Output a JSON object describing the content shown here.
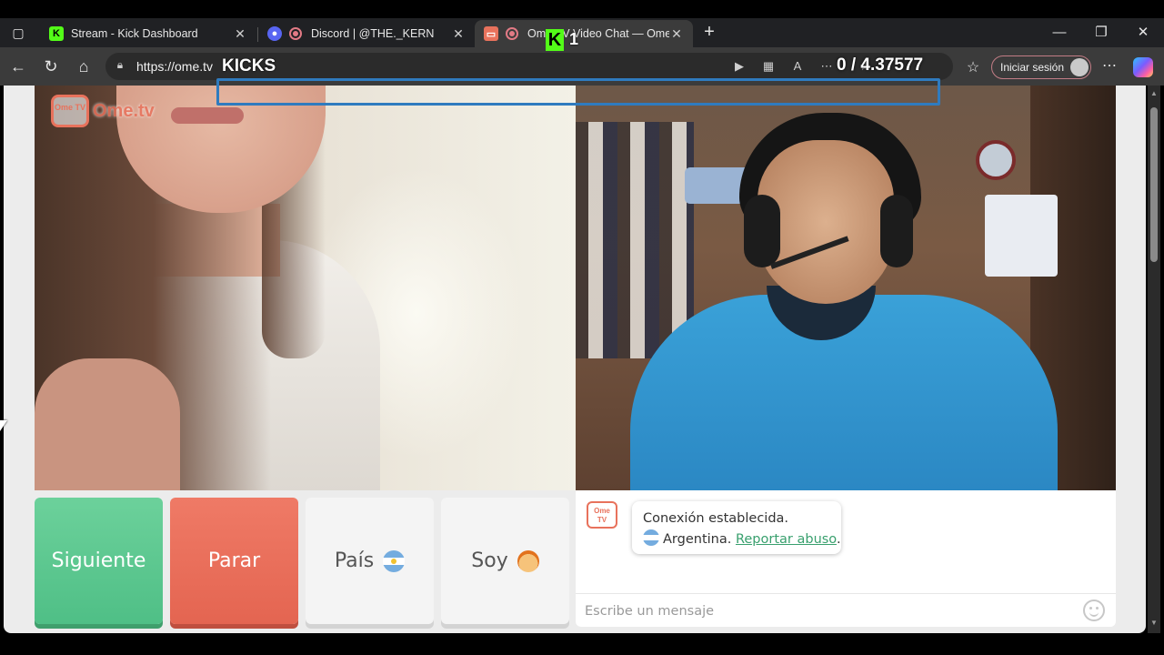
{
  "browser": {
    "tabs": [
      {
        "label": "Stream - Kick Dashboard",
        "favicon": "kick-icon",
        "active": false
      },
      {
        "label": "Discord | @THE._KERN",
        "favicon": "discord-icon",
        "active": false
      },
      {
        "label": "Ome.TV Video Chat — Omeg",
        "favicon": "ometv-icon",
        "active": true
      }
    ],
    "address": {
      "url": "https://ome.tv"
    },
    "signin_label": "Iniciar sesión",
    "colors": {
      "tabbar": "#202124",
      "toolbar": "#3b3b3b",
      "accent_rec": "#e27a85"
    }
  },
  "overlay": {
    "kicks_label": "KICKS",
    "kick_count": "1",
    "stats": "0 / 4.37577"
  },
  "site": {
    "logo_text": "Ome.tv",
    "logo_badge": "Ome TV",
    "buttons": {
      "next": "Siguiente",
      "stop": "Parar",
      "country": "País",
      "gender": "Soy"
    },
    "chat": {
      "connection": "Conexión establecida.",
      "country": "Argentina.",
      "report": "Reportar abuso",
      "report_suffix": ".",
      "placeholder": "Escribe un mensaje"
    },
    "colors": {
      "next": "#5cc893",
      "stop": "#e96f5b",
      "brand": "#e8725c",
      "link": "#39a06e"
    }
  }
}
